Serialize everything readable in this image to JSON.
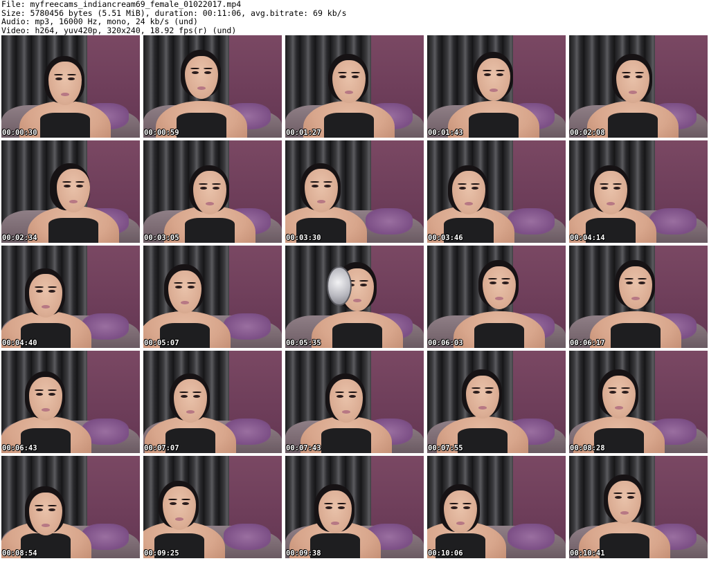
{
  "header": {
    "file_line": "File: myfreecams_indiancream69_female_01022017.mp4",
    "size_line": "Size: 5780456 bytes (5.51 MiB), duration: 00:11:06, avg.bitrate: 69 kb/s",
    "audio_line": "Audio: mp3, 16000 Hz, mono, 24 kb/s (und)",
    "video_line": "Video: h264, yuv420p, 320x240, 18.92 fps(r) (und)"
  },
  "thumbnails": [
    {
      "timestamp": "00:00:30"
    },
    {
      "timestamp": "00:00:59"
    },
    {
      "timestamp": "00:01:27"
    },
    {
      "timestamp": "00:01:43"
    },
    {
      "timestamp": "00:02:08"
    },
    {
      "timestamp": "00:02:34"
    },
    {
      "timestamp": "00:03:05"
    },
    {
      "timestamp": "00:03:30"
    },
    {
      "timestamp": "00:03:46"
    },
    {
      "timestamp": "00:04:14"
    },
    {
      "timestamp": "00:04:40"
    },
    {
      "timestamp": "00:05:07"
    },
    {
      "timestamp": "00:05:35"
    },
    {
      "timestamp": "00:06:03"
    },
    {
      "timestamp": "00:06:17"
    },
    {
      "timestamp": "00:06:43"
    },
    {
      "timestamp": "00:07:07"
    },
    {
      "timestamp": "00:07:43"
    },
    {
      "timestamp": "00:07:55"
    },
    {
      "timestamp": "00:08:28"
    },
    {
      "timestamp": "00:08:54"
    },
    {
      "timestamp": "00:09:25"
    },
    {
      "timestamp": "00:09:38"
    },
    {
      "timestamp": "00:10:06"
    },
    {
      "timestamp": "00:10:41"
    }
  ],
  "colors": {
    "background": "#ffffff",
    "header_text": "#000000",
    "timestamp_text": "#ffffff",
    "wall": "#6e3e5a"
  }
}
